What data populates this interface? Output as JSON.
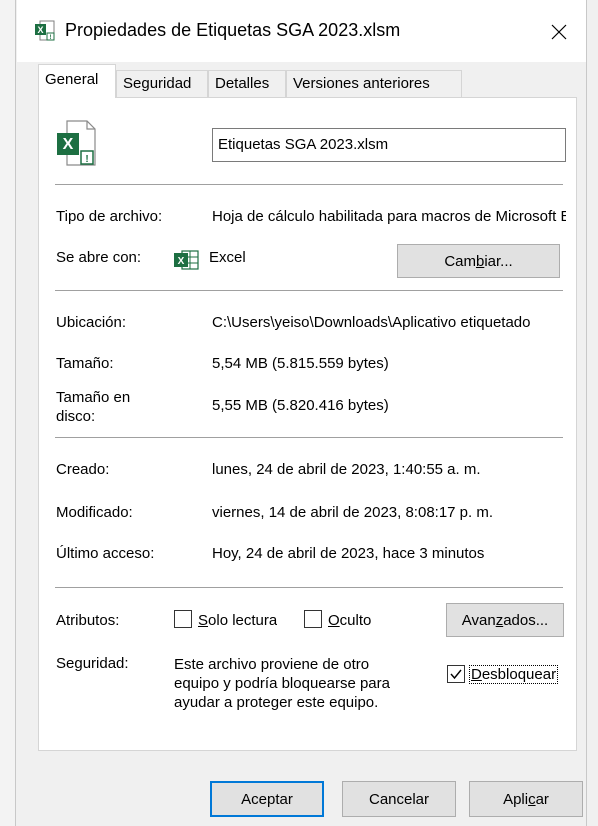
{
  "window": {
    "title": "Propiedades de Etiquetas SGA 2023.xlsm",
    "close_glyph": "✕"
  },
  "tabs": [
    {
      "label": "General",
      "active": true
    },
    {
      "label": "Seguridad",
      "active": false
    },
    {
      "label": "Detalles",
      "active": false
    },
    {
      "label": "Versiones anteriores",
      "active": false
    }
  ],
  "file": {
    "name": "Etiquetas SGA 2023.xlsm",
    "icon": "excel-macro-file-icon"
  },
  "type": {
    "label": "Tipo de archivo:",
    "value": "Hoja de cálculo habilitada para macros de Microsoft Excel"
  },
  "opens_with": {
    "label": "Se abre con:",
    "app": "Excel",
    "app_icon": "excel-icon",
    "change_button": {
      "pre": "Cam",
      "accel": "b",
      "post": "iar..."
    }
  },
  "location": {
    "label": "Ubicación:",
    "value": "C:\\Users\\yeiso\\Downloads\\Aplicativo etiquetado"
  },
  "size": {
    "label": "Tamaño:",
    "value": "5,54 MB (5.815.559 bytes)"
  },
  "disk_size": {
    "label_line1": "Tamaño en",
    "label_line2": "disco:",
    "value": "5,55 MB (5.820.416 bytes)"
  },
  "created": {
    "label": "Creado:",
    "value": "lunes, 24 de abril de 2023, 1:40:55 a. m."
  },
  "modified": {
    "label": "Modificado:",
    "value": "viernes, 14 de abril de 2023, 8:08:17 p. m."
  },
  "accessed": {
    "label": "Último acceso:",
    "value": "Hoy, 24 de abril de 2023, hace 3 minutos"
  },
  "attributes": {
    "label": "Atributos:",
    "readonly": {
      "accel": "S",
      "rest": "olo lectura",
      "checked": false
    },
    "hidden": {
      "accel": "O",
      "rest": "culto",
      "checked": false
    },
    "advanced_button": {
      "pre": "Avan",
      "accel": "z",
      "post": "ados..."
    }
  },
  "security": {
    "label": "Seguridad:",
    "line1": "Este archivo proviene de otro",
    "line2": "equipo y podría bloquearse para",
    "line3": "ayudar a proteger este equipo.",
    "unblock": {
      "accel": "D",
      "rest": "esbloquear",
      "checked": true
    }
  },
  "footer": {
    "ok": "Aceptar",
    "cancel": "Cancelar",
    "apply": {
      "pre": "Apli",
      "accel": "c",
      "post": "ar"
    }
  },
  "colors": {
    "excel_green": "#1d6f42",
    "accent_blue": "#0078d7"
  }
}
